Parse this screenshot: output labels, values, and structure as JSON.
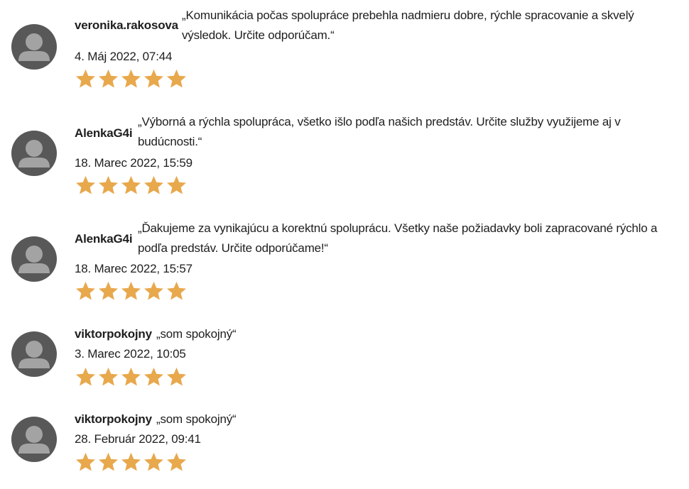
{
  "colors": {
    "star": "#e8a84c",
    "avatar_bg": "#585858",
    "avatar_fg": "#a3a3a3"
  },
  "icons": {
    "avatar": "user-avatar-icon",
    "star": "star-icon"
  },
  "reviews": [
    {
      "username": "veronika.rakosova",
      "comment": "„Komunikácia počas spolupráce prebehla nadmieru dobre, rýchle spracovanie a skvelý výsledok. Určite odporúčam.“",
      "date": "4. Máj 2022, 07:44",
      "rating": 5
    },
    {
      "username": "AlenkaG4i",
      "comment": "„Výborná a rýchla spolupráca, všetko išlo podľa našich predstáv. Určite služby využijeme aj v budúcnosti.“",
      "date": "18. Marec 2022, 15:59",
      "rating": 5
    },
    {
      "username": "AlenkaG4i",
      "comment": "„Ďakujeme za vynikajúcu a korektnú spoluprácu. Všetky naše požiadavky boli zapracované rýchlo a podľa predstáv. Určite odporúčame!“",
      "date": "18. Marec 2022, 15:57",
      "rating": 5
    },
    {
      "username": "viktorpokojny",
      "comment": "„som spokojný“",
      "date": "3. Marec 2022, 10:05",
      "rating": 5
    },
    {
      "username": "viktorpokojny",
      "comment": "„som spokojný“",
      "date": "28. Február 2022, 09:41",
      "rating": 5
    }
  ]
}
